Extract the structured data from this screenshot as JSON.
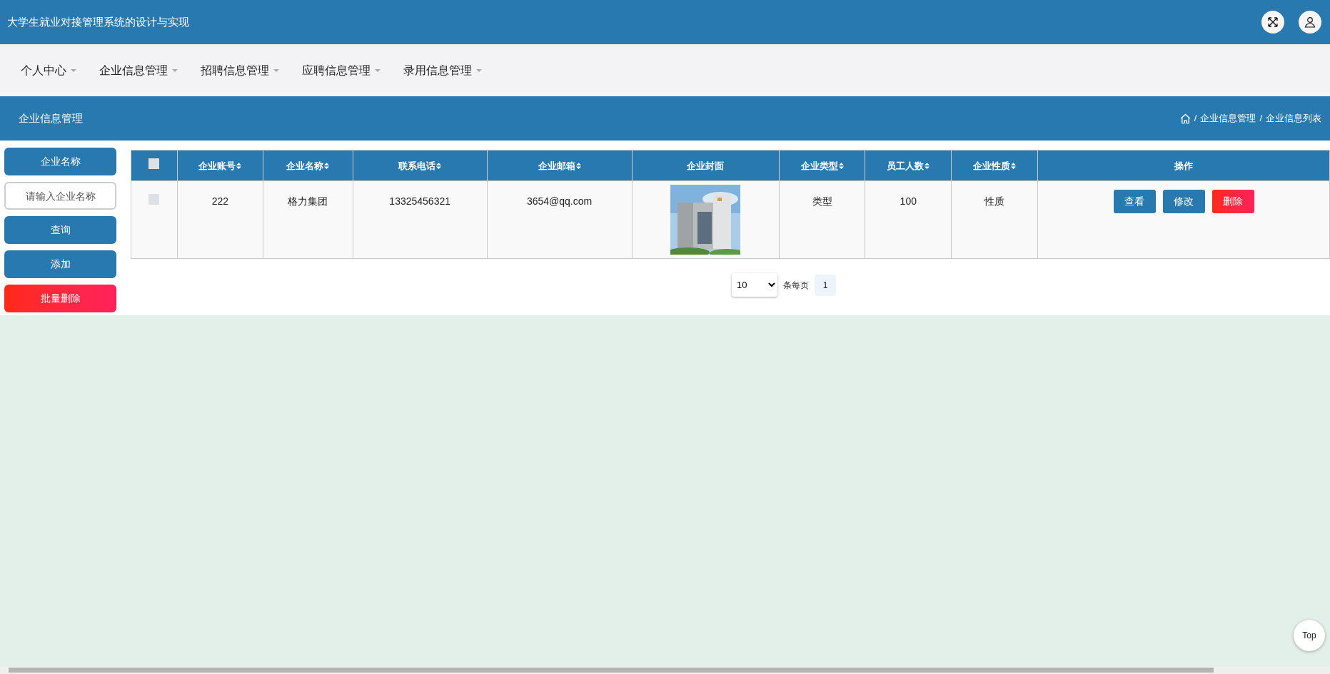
{
  "header": {
    "title": "大学生就业对接管理系统的设计与实现"
  },
  "nav": [
    {
      "label": "个人中心"
    },
    {
      "label": "企业信息管理"
    },
    {
      "label": "招聘信息管理"
    },
    {
      "label": "应聘信息管理"
    },
    {
      "label": "录用信息管理"
    }
  ],
  "page_title": "企业信息管理",
  "breadcrumb": {
    "separator": "/",
    "items": [
      "企业信息管理",
      "企业信息列表"
    ]
  },
  "sidebar": {
    "field_label": "企业名称",
    "search_field": {
      "placeholder": "请输入企业名称"
    },
    "buttons": [
      {
        "label": "查询",
        "kind": "primary"
      },
      {
        "label": "添加",
        "kind": "primary"
      },
      {
        "label": "批量删除",
        "kind": "danger"
      }
    ]
  },
  "table": {
    "select_all": {
      "checked": false
    },
    "columns": [
      {
        "label": "企业账号",
        "sortable": true
      },
      {
        "label": "企业名称",
        "sortable": true
      },
      {
        "label": "联系电话",
        "sortable": true
      },
      {
        "label": "企业邮箱",
        "sortable": true
      },
      {
        "label": "企业封面",
        "sortable": false
      },
      {
        "label": "企业类型",
        "sortable": true
      },
      {
        "label": "员工人数",
        "sortable": true
      },
      {
        "label": "企业性质",
        "sortable": true
      },
      {
        "label": "操作",
        "sortable": false
      }
    ],
    "rows": [
      {
        "checked": false,
        "cells": [
          "222",
          "格力集团",
          "13325456321",
          "3654@qq.com",
          {
            "kind": "picture"
          },
          "类型",
          "100",
          "性质"
        ],
        "actions": [
          {
            "label": "查看",
            "kind": "primary"
          },
          {
            "label": "修改",
            "kind": "primary"
          },
          {
            "label": "删除",
            "kind": "danger"
          }
        ]
      }
    ]
  },
  "pagination": {
    "page_size": "10",
    "page_size_label": "条每页",
    "pages": [
      {
        "label": "1",
        "selected": true
      }
    ]
  },
  "top_button": {
    "label": "Top"
  }
}
